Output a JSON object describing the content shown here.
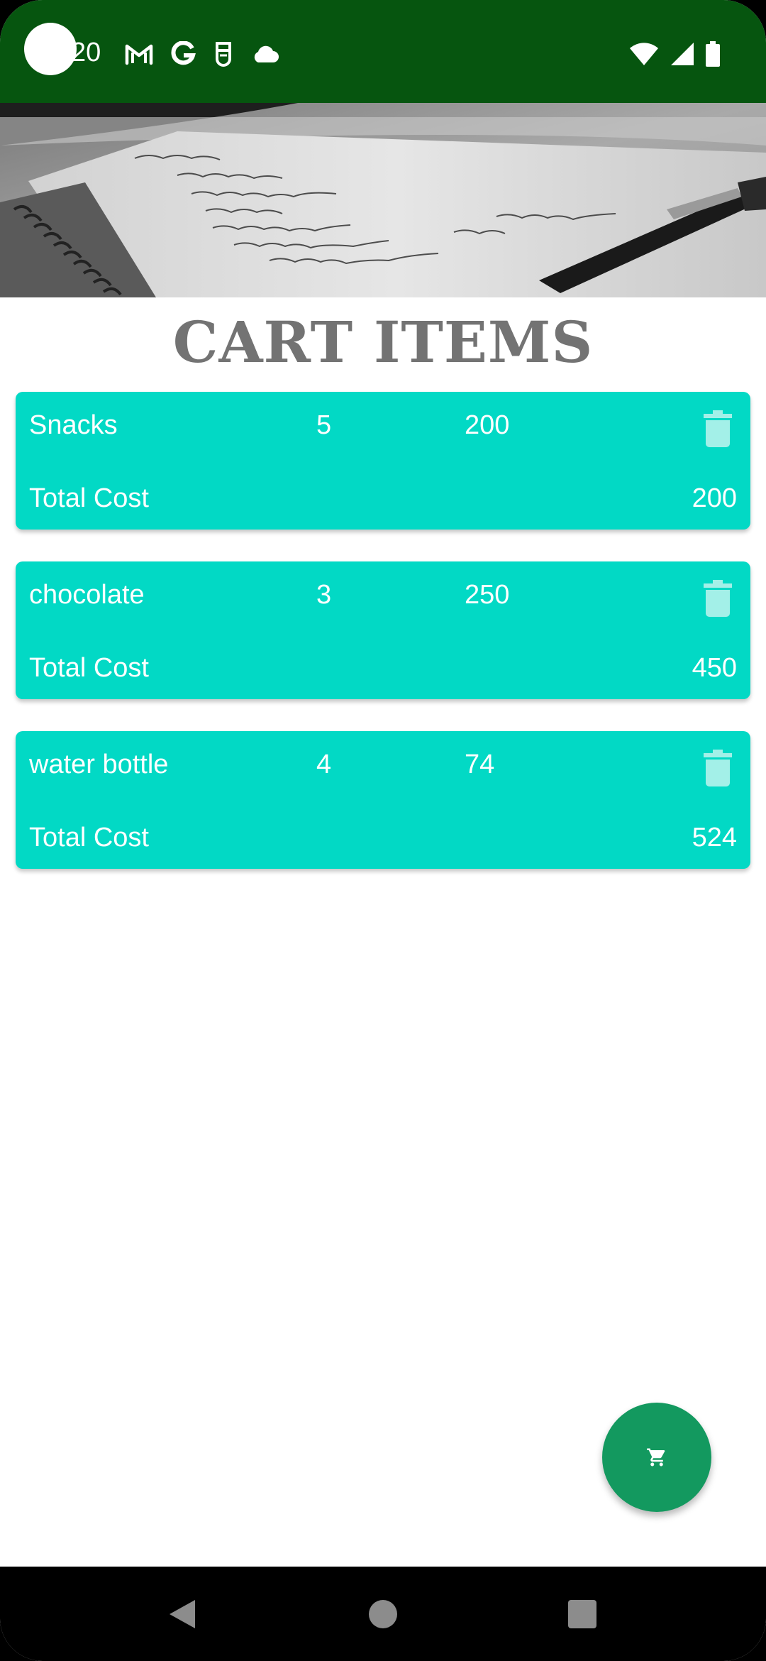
{
  "status_bar": {
    "time": "20",
    "icons_left": [
      "gmail-icon",
      "google-icon",
      "face-icon",
      "cloud-icon"
    ],
    "icons_right": [
      "wifi-icon",
      "signal-icon",
      "battery-icon"
    ],
    "background": "#06550F"
  },
  "page": {
    "title": "CART ITEMS",
    "title_color": "#737373"
  },
  "cart": {
    "card_color": "#02D9C5",
    "items": [
      {
        "name": "Snacks",
        "quantity": "5",
        "price": "200",
        "total_label": "Total Cost",
        "total_value": "200"
      },
      {
        "name": "chocolate",
        "quantity": "3",
        "price": "250",
        "total_label": "Total Cost",
        "total_value": "450"
      },
      {
        "name": "water bottle",
        "quantity": "4",
        "price": "74",
        "total_label": "Total Cost",
        "total_value": "524"
      }
    ]
  },
  "fab": {
    "icon": "cart-icon",
    "color": "#13995F"
  },
  "nav_bar": {
    "buttons": [
      "back-icon",
      "home-icon",
      "recents-icon"
    ]
  }
}
